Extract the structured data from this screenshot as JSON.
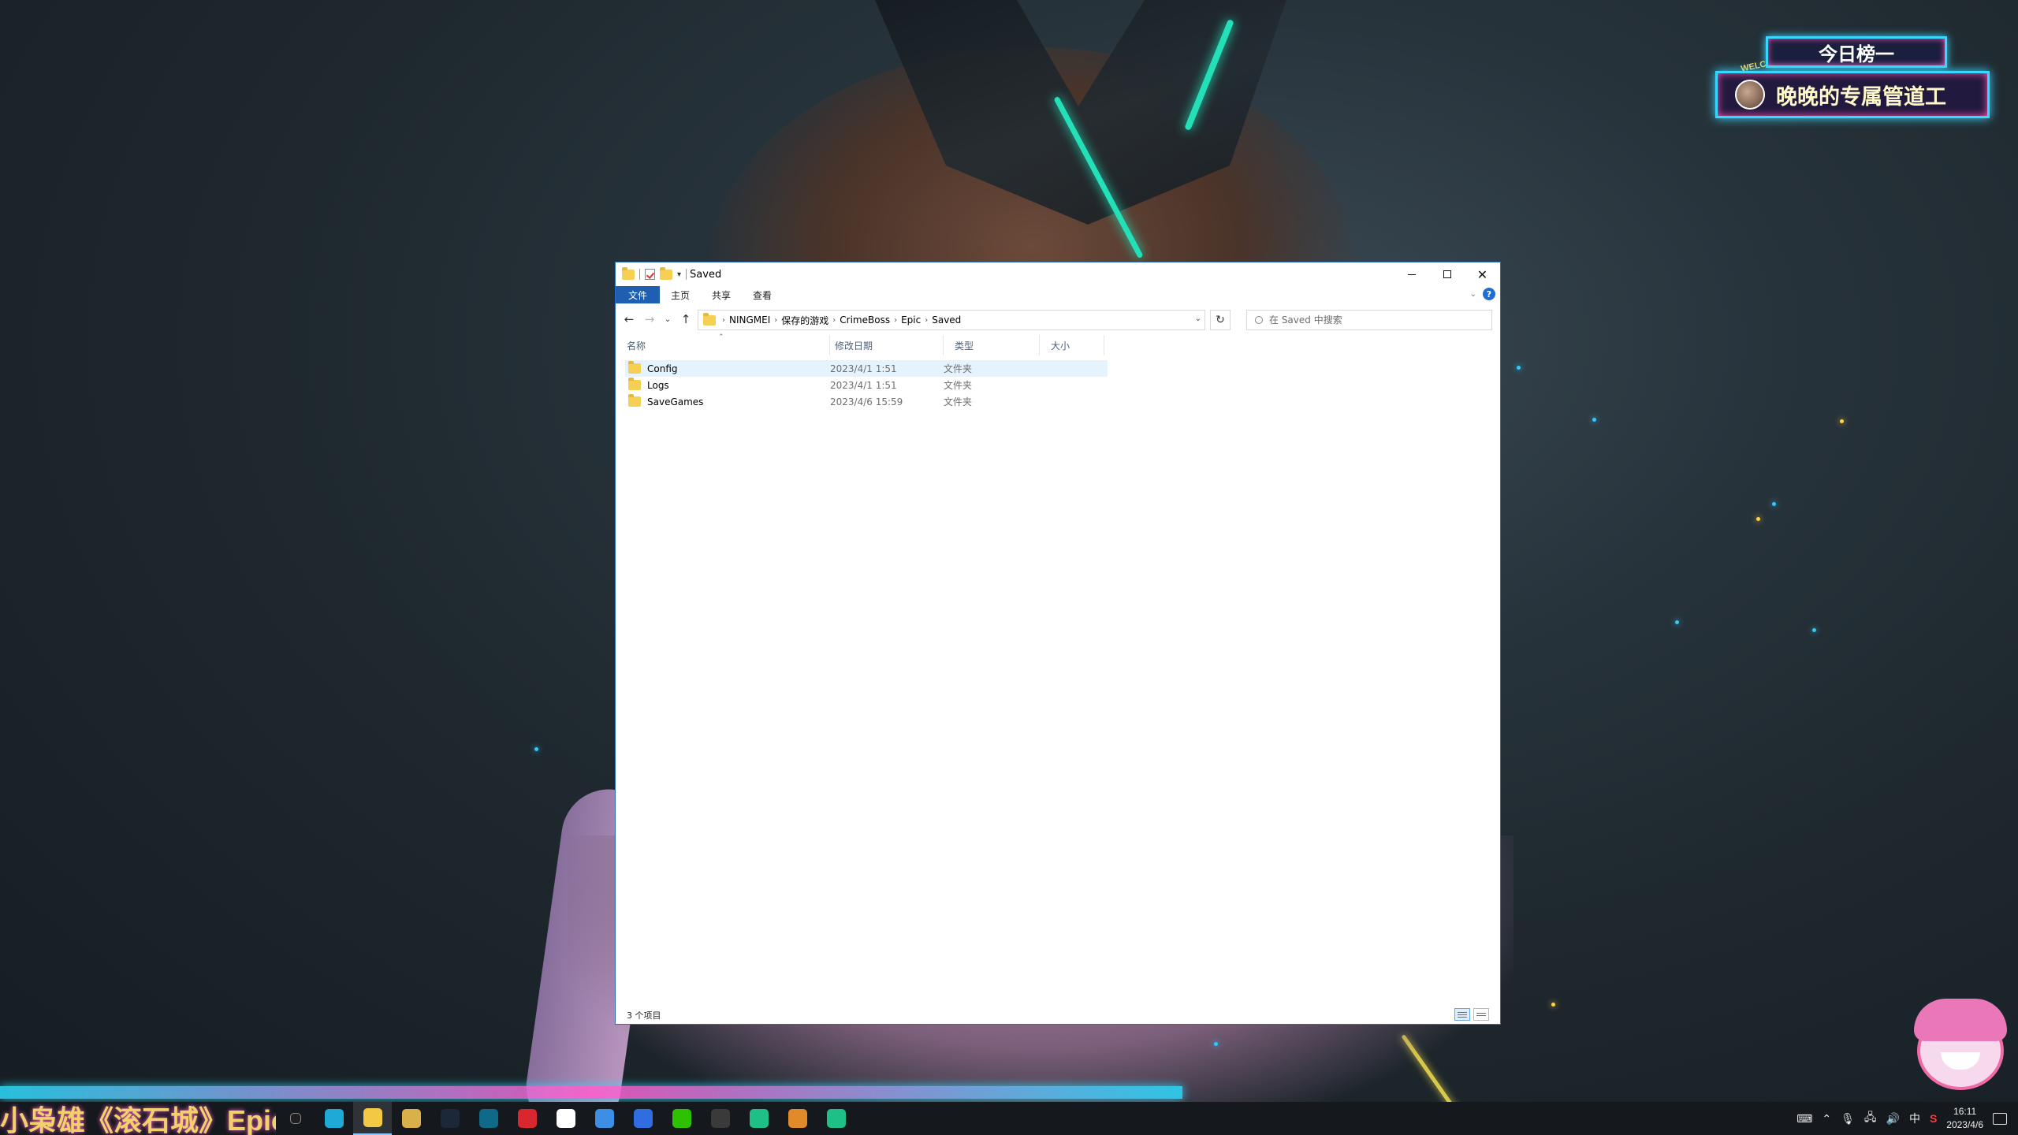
{
  "explorer": {
    "title": "Saved",
    "ribbon_tabs": [
      "文件",
      "主页",
      "共享",
      "查看"
    ],
    "breadcrumb": [
      "NINGMEI",
      "保存的游戏",
      "CrimeBoss",
      "Epic",
      "Saved"
    ],
    "search_placeholder": "在 Saved 中搜索",
    "columns": {
      "name": "名称",
      "date": "修改日期",
      "type": "类型",
      "size": "大小"
    },
    "files": [
      {
        "name": "Config",
        "date": "2023/4/1 1:51",
        "type": "文件夹",
        "size": ""
      },
      {
        "name": "Logs",
        "date": "2023/4/1 1:51",
        "type": "文件夹",
        "size": ""
      },
      {
        "name": "SaveGames",
        "date": "2023/4/6 15:59",
        "type": "文件夹",
        "size": ""
      }
    ],
    "status": "3 个项目",
    "selected_index": 0
  },
  "overlay": {
    "rank_title": "今日榜一",
    "rank_welcome": "WELCOME",
    "rank_user": "晚晚的专属管道工",
    "ticker_text": "小枭雄《滚石城》Epic"
  },
  "taskbar": {
    "apps": [
      {
        "icon": "terminal-icon",
        "color": "#1e1e1e"
      },
      {
        "icon": "edge-icon",
        "color": "#1fa9d6"
      },
      {
        "icon": "file-explorer-icon",
        "color": "#f3c845"
      },
      {
        "icon": "game-owl-icon",
        "color": "#d9b04a"
      },
      {
        "icon": "steam-icon",
        "color": "#1b2838"
      },
      {
        "icon": "epic-icon",
        "color": "#0f6a8a"
      },
      {
        "icon": "netease-music-icon",
        "color": "#d8272d"
      },
      {
        "icon": "capcut-icon",
        "color": "#ffffff"
      },
      {
        "icon": "visual-studio-icon",
        "color": "#3c8fe4"
      },
      {
        "icon": "kook-icon",
        "color": "#2f6de0"
      },
      {
        "icon": "wechat-icon",
        "color": "#2ec100"
      },
      {
        "icon": "obs-icon",
        "color": "#3a3a3a"
      },
      {
        "icon": "nb-app-icon",
        "color": "#1fbf88"
      },
      {
        "icon": "box-app-icon",
        "color": "#e08a2a"
      },
      {
        "icon": "nb-app-2-icon",
        "color": "#1fbf88"
      }
    ],
    "ime_label": "中",
    "time": "16:11",
    "date": "2023/4/6"
  }
}
